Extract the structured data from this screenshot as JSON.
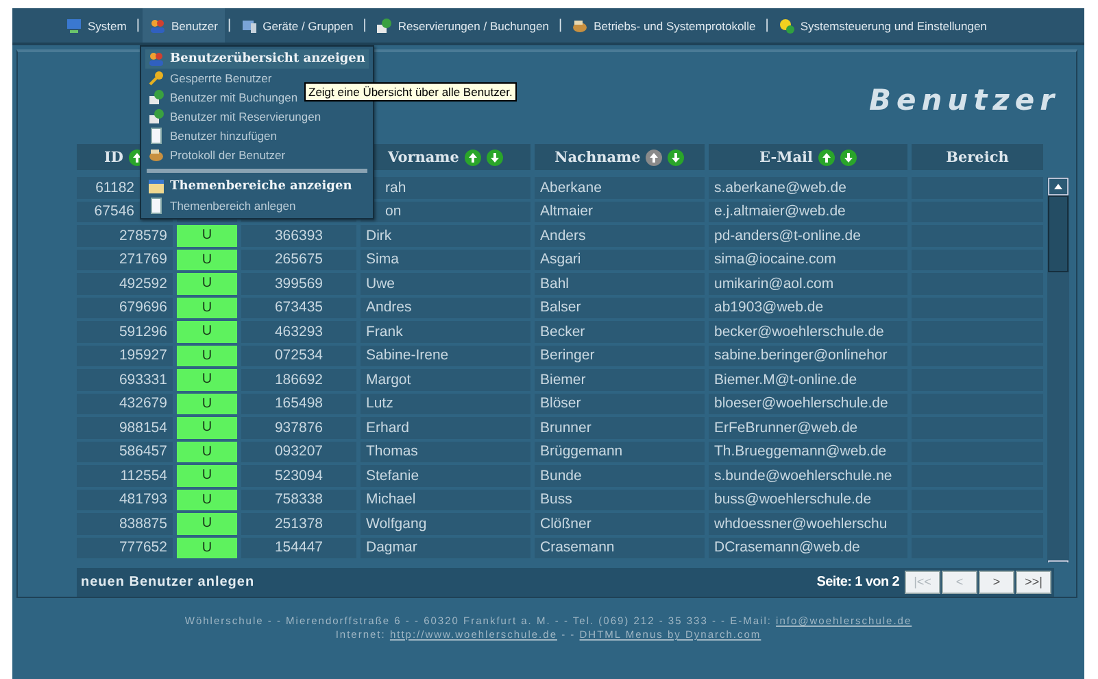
{
  "menubar": [
    {
      "label": "System",
      "selected": false
    },
    {
      "divider": "|",
      "label": "Benutzer",
      "selected": true
    },
    {
      "divider": "|",
      "label": "Geräte / Gruppen",
      "selected": false
    },
    {
      "divider": "|",
      "label": "Reservierungen / Buchungen",
      "selected": false
    },
    {
      "divider": "|",
      "label": "Betriebs- und Systemprotokolle",
      "selected": false
    },
    {
      "divider": "|",
      "label": "Systemsteuerung und Einstellungen",
      "selected": false
    }
  ],
  "dropdown": [
    {
      "kind": "item",
      "label": "Benutzerübersicht anzeigen",
      "bold": true,
      "selected": true
    },
    {
      "kind": "item",
      "label": "Gesperrte Benutzer",
      "bold": false,
      "selected": false
    },
    {
      "kind": "item",
      "label": "Benutzer mit Buchungen",
      "bold": false,
      "selected": false
    },
    {
      "kind": "item",
      "label": "Benutzer mit Reservierungen",
      "bold": false,
      "selected": false
    },
    {
      "kind": "item",
      "label": "Benutzer hinzufügen",
      "bold": false,
      "selected": false
    },
    {
      "kind": "item",
      "label": "Protokoll der Benutzer",
      "bold": false,
      "selected": false
    },
    {
      "kind": "separator"
    },
    {
      "kind": "item",
      "label": "Themenbereiche anzeigen",
      "bold": true,
      "selected": false
    },
    {
      "kind": "item",
      "label": "Themenbereich anlegen",
      "bold": false,
      "selected": false
    }
  ],
  "tooltip": "Zeigt eine Übersicht über alle Benutzer.",
  "page_title": "Benutzer",
  "table": {
    "columns": [
      {
        "label": "ID",
        "sorted": false
      },
      {},
      {},
      {
        "label": "Vorname",
        "sorted": false
      },
      {
        "label": "Nachname",
        "sorted": true
      },
      {
        "label": "E-Mail",
        "sorted": false
      },
      {
        "label": "Bereich"
      }
    ],
    "rows": [
      {
        "id": "61182",
        "first_name": "rah",
        "last_name": "Aberkane",
        "email": "s.aberkane@web.de"
      },
      {
        "id": "67546",
        "first_name": "on",
        "last_name": "Altmaier",
        "email": "e.j.altmaier@web.de"
      },
      {
        "id": "278579",
        "status": "U",
        "number": "366393",
        "first_name": "Dirk",
        "last_name": "Anders",
        "email": "pd-anders@t-online.de"
      },
      {
        "id": "271769",
        "status": "U",
        "number": "265675",
        "first_name": "Sima",
        "last_name": "Asgari",
        "email": "sima@iocaine.com"
      },
      {
        "id": "492592",
        "status": "U",
        "number": "399569",
        "first_name": "Uwe",
        "last_name": "Bahl",
        "email": "umikarin@aol.com"
      },
      {
        "id": "679696",
        "status": "U",
        "number": "673435",
        "first_name": "Andres",
        "last_name": "Balser",
        "email": "ab1903@web.de"
      },
      {
        "id": "591296",
        "status": "U",
        "number": "463293",
        "first_name": "Frank",
        "last_name": "Becker",
        "email": "becker@woehlerschule.de"
      },
      {
        "id": "195927",
        "status": "U",
        "number": "072534",
        "first_name": "Sabine-Irene",
        "last_name": "Beringer",
        "email": "sabine.beringer@onlinehor"
      },
      {
        "id": "693331",
        "status": "U",
        "number": "186692",
        "first_name": "Margot",
        "last_name": "Biemer",
        "email": "Biemer.M@t-online.de"
      },
      {
        "id": "432679",
        "status": "U",
        "number": "165498",
        "first_name": "Lutz",
        "last_name": "Blöser",
        "email": "bloeser@woehlerschule.de"
      },
      {
        "id": "988154",
        "status": "U",
        "number": "937876",
        "first_name": "Erhard",
        "last_name": "Brunner",
        "email": "ErFeBrunner@web.de"
      },
      {
        "id": "586457",
        "status": "U",
        "number": "093207",
        "first_name": "Thomas",
        "last_name": "Brüggemann",
        "email": "Th.Brueggemann@web.de"
      },
      {
        "id": "112554",
        "status": "U",
        "number": "523094",
        "first_name": "Stefanie",
        "last_name": "Bunde",
        "email": "s.bunde@woehlerschule.ne"
      },
      {
        "id": "481793",
        "status": "U",
        "number": "758338",
        "first_name": "Michael",
        "last_name": "Buss",
        "email": "buss@woehlerschule.de"
      },
      {
        "id": "838875",
        "status": "U",
        "number": "251378",
        "first_name": "Wolfgang",
        "last_name": "Clößner",
        "email": "whdoessner@woehlerschu"
      },
      {
        "id": "777652",
        "status": "U",
        "number": "154447",
        "first_name": "Dagmar",
        "last_name": "Crasemann",
        "email": "DCrasemann@web.de"
      }
    ]
  },
  "new_user_link": "neuen Benutzer anlegen",
  "pager": {
    "label": "Seite: 1 von 2",
    "buttons": [
      {
        "label": "|<<",
        "disabled": true
      },
      {
        "label": "<",
        "disabled": true
      },
      {
        "label": ">",
        "disabled": false
      },
      {
        "label": ">>|",
        "disabled": false
      }
    ]
  },
  "footer": [
    {
      "text": "Wöhlerschule - - Mierendorffstraße 6 - - 60320 Frankfurt a. M. - - Tel. (069) 212 - 35 333 - - E-Mail: ",
      "links": [
        "info@woehlerschule.de"
      ]
    },
    {
      "text": "Internet: ",
      "links": [
        "http://www.woehlerschule.de",
        "DHTML Menus by Dynarch.com"
      ],
      "joiner": " - - "
    }
  ]
}
